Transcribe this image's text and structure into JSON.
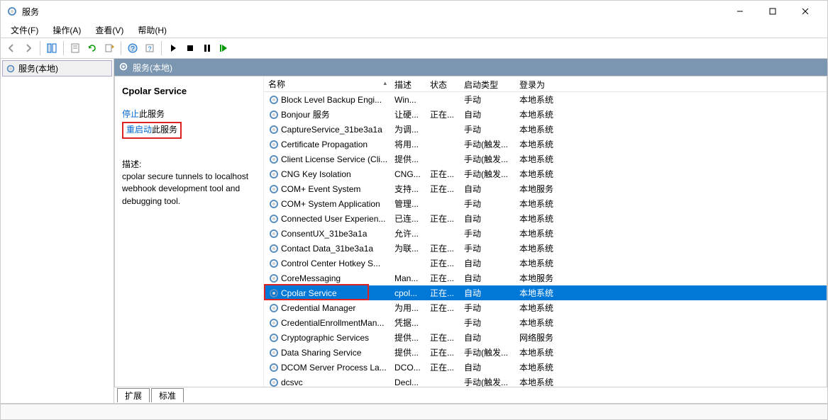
{
  "window": {
    "title": "服务"
  },
  "menubar": [
    "文件(F)",
    "操作(A)",
    "查看(V)",
    "帮助(H)"
  ],
  "nav": {
    "root": "服务(本地)"
  },
  "content_header": "服务(本地)",
  "details": {
    "title": "Cpolar Service",
    "stop_link_prefix": "停止",
    "stop_link_suffix": "此服务",
    "restart_link_prefix": "重启动",
    "restart_link_suffix": "此服务",
    "desc_label": "描述:",
    "desc_text": "cpolar secure tunnels to localhost webhook development tool and debugging tool."
  },
  "columns": {
    "name": "名称",
    "desc": "描述",
    "status": "状态",
    "start": "启动类型",
    "logon": "登录为"
  },
  "tabs": {
    "extended": "扩展",
    "standard": "标准"
  },
  "services": [
    {
      "name": "Block Level Backup Engi...",
      "desc": "Win...",
      "status": "",
      "start": "手动",
      "logon": "本地系统",
      "sel": false
    },
    {
      "name": "Bonjour 服务",
      "desc": "让硬...",
      "status": "正在...",
      "start": "自动",
      "logon": "本地系统",
      "sel": false
    },
    {
      "name": "CaptureService_31be3a1a",
      "desc": "为调...",
      "status": "",
      "start": "手动",
      "logon": "本地系统",
      "sel": false
    },
    {
      "name": "Certificate Propagation",
      "desc": "将用...",
      "status": "",
      "start": "手动(触发...",
      "logon": "本地系统",
      "sel": false
    },
    {
      "name": "Client License Service (Cli...",
      "desc": "提供...",
      "status": "",
      "start": "手动(触发...",
      "logon": "本地系统",
      "sel": false
    },
    {
      "name": "CNG Key Isolation",
      "desc": "CNG...",
      "status": "正在...",
      "start": "手动(触发...",
      "logon": "本地系统",
      "sel": false
    },
    {
      "name": "COM+ Event System",
      "desc": "支持...",
      "status": "正在...",
      "start": "自动",
      "logon": "本地服务",
      "sel": false
    },
    {
      "name": "COM+ System Application",
      "desc": "管理...",
      "status": "",
      "start": "手动",
      "logon": "本地系统",
      "sel": false
    },
    {
      "name": "Connected User Experien...",
      "desc": "已连...",
      "status": "正在...",
      "start": "自动",
      "logon": "本地系统",
      "sel": false
    },
    {
      "name": "ConsentUX_31be3a1a",
      "desc": "允许...",
      "status": "",
      "start": "手动",
      "logon": "本地系统",
      "sel": false
    },
    {
      "name": "Contact Data_31be3a1a",
      "desc": "为联...",
      "status": "正在...",
      "start": "手动",
      "logon": "本地系统",
      "sel": false
    },
    {
      "name": "Control Center Hotkey S...",
      "desc": "",
      "status": "正在...",
      "start": "自动",
      "logon": "本地系统",
      "sel": false
    },
    {
      "name": "CoreMessaging",
      "desc": "Man...",
      "status": "正在...",
      "start": "自动",
      "logon": "本地服务",
      "sel": false
    },
    {
      "name": "Cpolar Service",
      "desc": "cpol...",
      "status": "正在...",
      "start": "自动",
      "logon": "本地系统",
      "sel": true
    },
    {
      "name": "Credential Manager",
      "desc": "为用...",
      "status": "正在...",
      "start": "手动",
      "logon": "本地系统",
      "sel": false
    },
    {
      "name": "CredentialEnrollmentMan...",
      "desc": "凭据...",
      "status": "",
      "start": "手动",
      "logon": "本地系统",
      "sel": false
    },
    {
      "name": "Cryptographic Services",
      "desc": "提供...",
      "status": "正在...",
      "start": "自动",
      "logon": "网络服务",
      "sel": false
    },
    {
      "name": "Data Sharing Service",
      "desc": "提供...",
      "status": "正在...",
      "start": "手动(触发...",
      "logon": "本地系统",
      "sel": false
    },
    {
      "name": "DCOM Server Process La...",
      "desc": "DCO...",
      "status": "正在...",
      "start": "自动",
      "logon": "本地系统",
      "sel": false
    },
    {
      "name": "dcsvc",
      "desc": "Decl...",
      "status": "",
      "start": "手动(触发...",
      "logon": "本地系统",
      "sel": false
    }
  ]
}
